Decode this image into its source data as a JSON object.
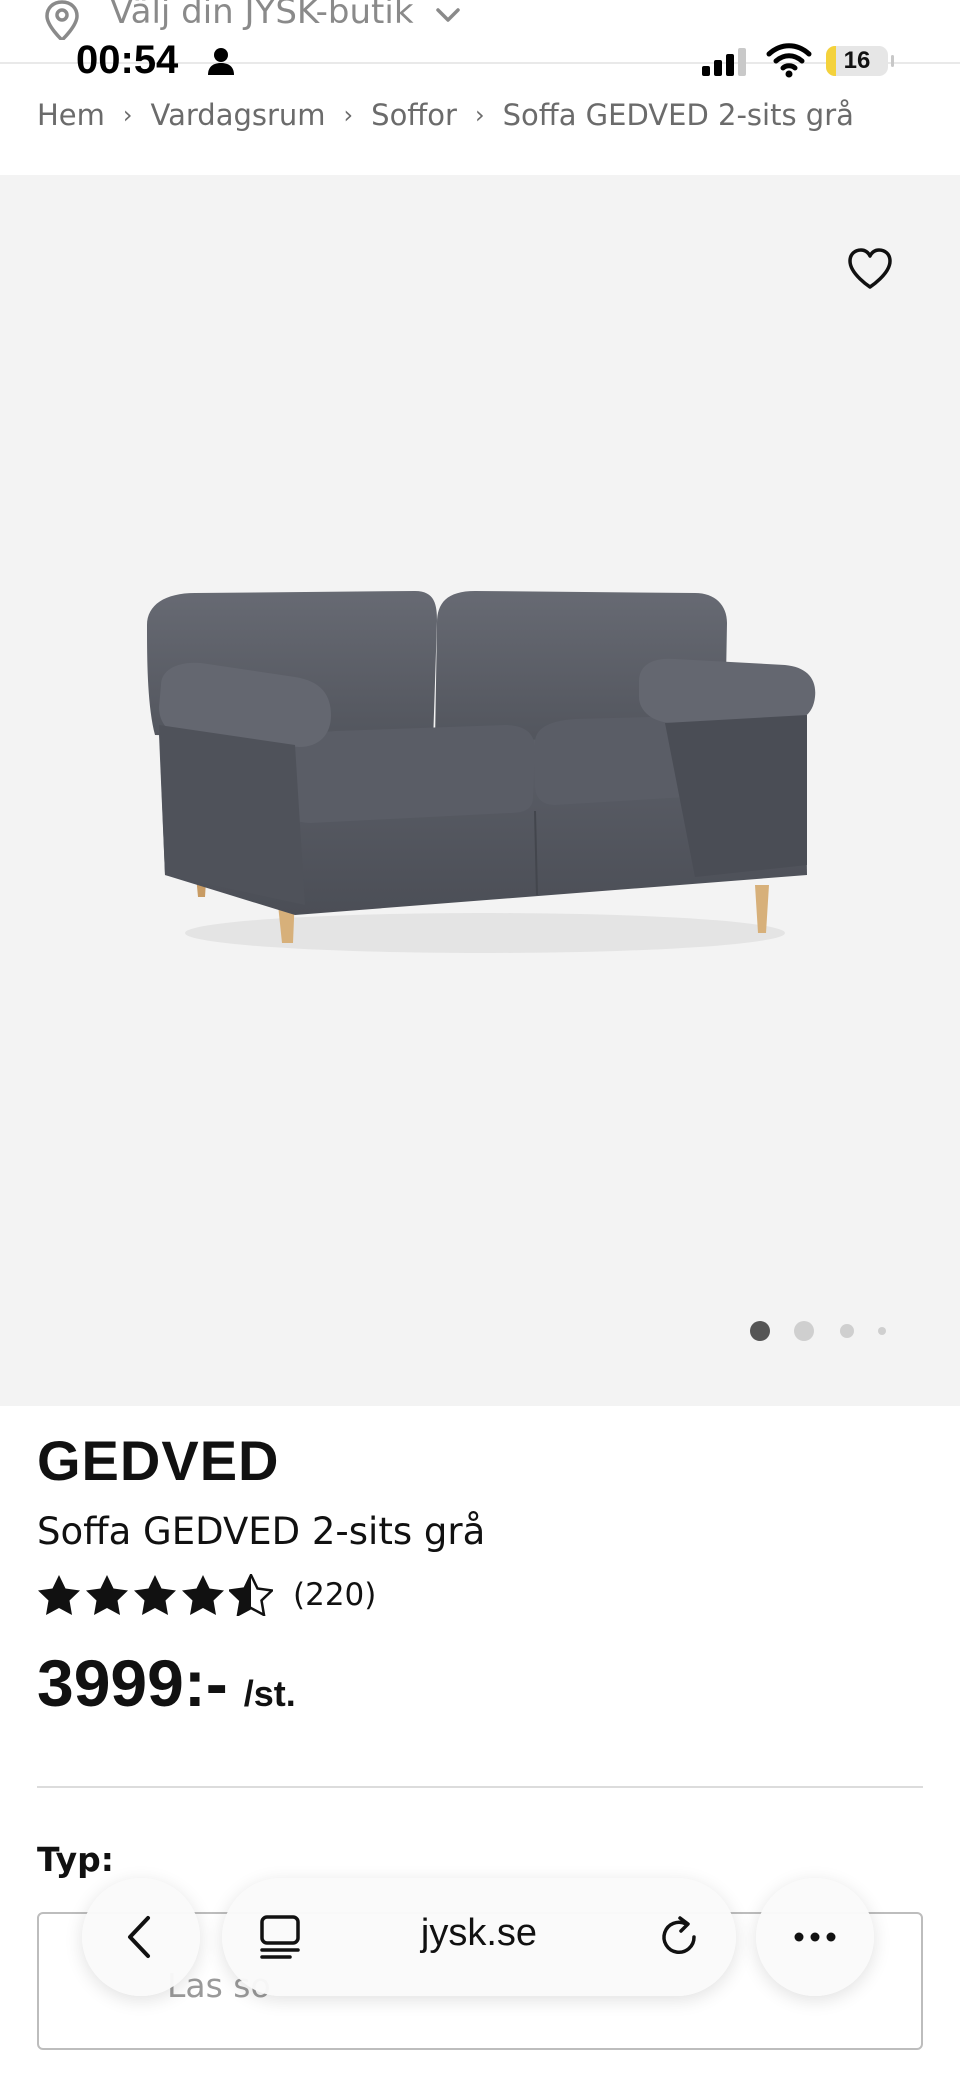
{
  "store_bar": {
    "label": "Välj din JYSK-butik",
    "pin_icon": "location-pin-icon",
    "chevron_icon": "chevron-down-icon"
  },
  "status_bar": {
    "time": "00:54",
    "battery_percent": 16,
    "battery_label": "16"
  },
  "breadcrumb": {
    "items": [
      "Hem",
      "Vardagsrum",
      "Soffor",
      "Soffa GEDVED 2-sits grå"
    ]
  },
  "gallery": {
    "favorite_icon": "heart-icon",
    "slide_count": 4,
    "active_slide": 1
  },
  "product": {
    "brand": "GEDVED",
    "name": "Soffa GEDVED 2-sits grå",
    "rating": 4.5,
    "review_count": "(220)",
    "price": "3999:-",
    "unit": "/st."
  },
  "variant": {
    "label": "Typ:",
    "selected_value": "Las so"
  },
  "browser": {
    "url": "jysk.se",
    "back_icon": "chevron-left-icon",
    "tabs_icon": "tabs-icon",
    "reload_icon": "reload-icon",
    "more_icon": "more-icon"
  },
  "colors": {
    "gallery_bg": "#f3f3f3",
    "sofa": "#5b5e66",
    "text": "#111111",
    "muted": "#6b6b6b"
  }
}
